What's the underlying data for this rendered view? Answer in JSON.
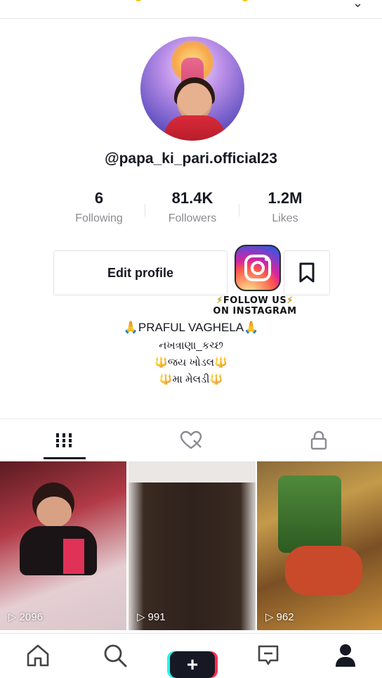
{
  "profile": {
    "username": "@papa_ki_pari.official23",
    "stats": [
      {
        "value": "6",
        "label": "Following"
      },
      {
        "value": "81.4K",
        "label": "Followers"
      },
      {
        "value": "1.2M",
        "label": "Likes"
      }
    ],
    "edit_button": "Edit profile",
    "instagram_overlay": {
      "line1": "FOLLOW US",
      "line2": "ON INSTAGRAM"
    },
    "bio": {
      "line1": "PRAFUL VAGHELA",
      "line2": "નખત્રાણા_કચ્છ",
      "line3": "જય ખોડલ",
      "line4": "મા મેલડી"
    }
  },
  "videos": [
    {
      "views": "2096"
    },
    {
      "views": "991"
    },
    {
      "views": "962"
    }
  ],
  "colors": {
    "text_primary": "#161823",
    "text_secondary": "#8a8b91",
    "accent_cyan": "#25f4ee",
    "accent_red": "#fe2c55"
  }
}
